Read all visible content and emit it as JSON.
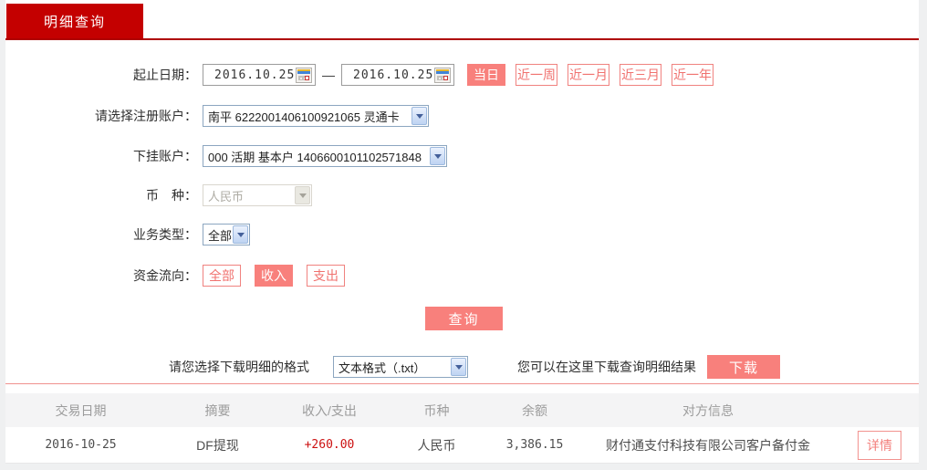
{
  "colors": {
    "brand_red": "#c40000",
    "underline_red": "#ae0000",
    "accent_salmon": "#f8807c",
    "divider_salmon": "#f0918e",
    "amount_red": "#cc1111",
    "header_gray_bg": "#f4f4f5"
  },
  "tab": {
    "label": "明细查询"
  },
  "form": {
    "date_range": {
      "label": "起止日期：",
      "from": "2016.10.25",
      "to": "2016.10.25",
      "separator": "—"
    },
    "quick_ranges": [
      {
        "label": "当日",
        "active": true
      },
      {
        "label": "近一周",
        "active": false
      },
      {
        "label": "近一月",
        "active": false
      },
      {
        "label": "近三月",
        "active": false
      },
      {
        "label": "近一年",
        "active": false
      }
    ],
    "registered_account": {
      "label": "请选择注册账户：",
      "value": "南平 6222001406100921065 灵通卡"
    },
    "sub_account": {
      "label": "下挂账户：",
      "value": "000 活期 基本户 1406600101102571848"
    },
    "currency": {
      "label": "币　种：",
      "value": "人民币",
      "disabled": true
    },
    "business_type": {
      "label": "业务类型：",
      "value": "全部"
    },
    "fund_flow": {
      "label": "资金流向：",
      "options": [
        {
          "label": "全部",
          "active": false
        },
        {
          "label": "收入",
          "active": true
        },
        {
          "label": "支出",
          "active": false
        }
      ]
    },
    "query_button": "查询"
  },
  "download": {
    "format_label": "请您选择下载明细的格式",
    "format_value": "文本格式（.txt）",
    "hint": "您可以在这里下载查询明细结果",
    "button": "下载"
  },
  "table": {
    "headers": [
      "交易日期",
      "摘要",
      "收入/支出",
      "币种",
      "余额",
      "对方信息"
    ],
    "rows": [
      {
        "date": "2016-10-25",
        "summary": "DF提现",
        "amount": "+260.00",
        "currency": "人民币",
        "balance": "3,386.15",
        "counterparty": "财付通支付科技有限公司客户备付金",
        "action": "详情"
      }
    ]
  }
}
